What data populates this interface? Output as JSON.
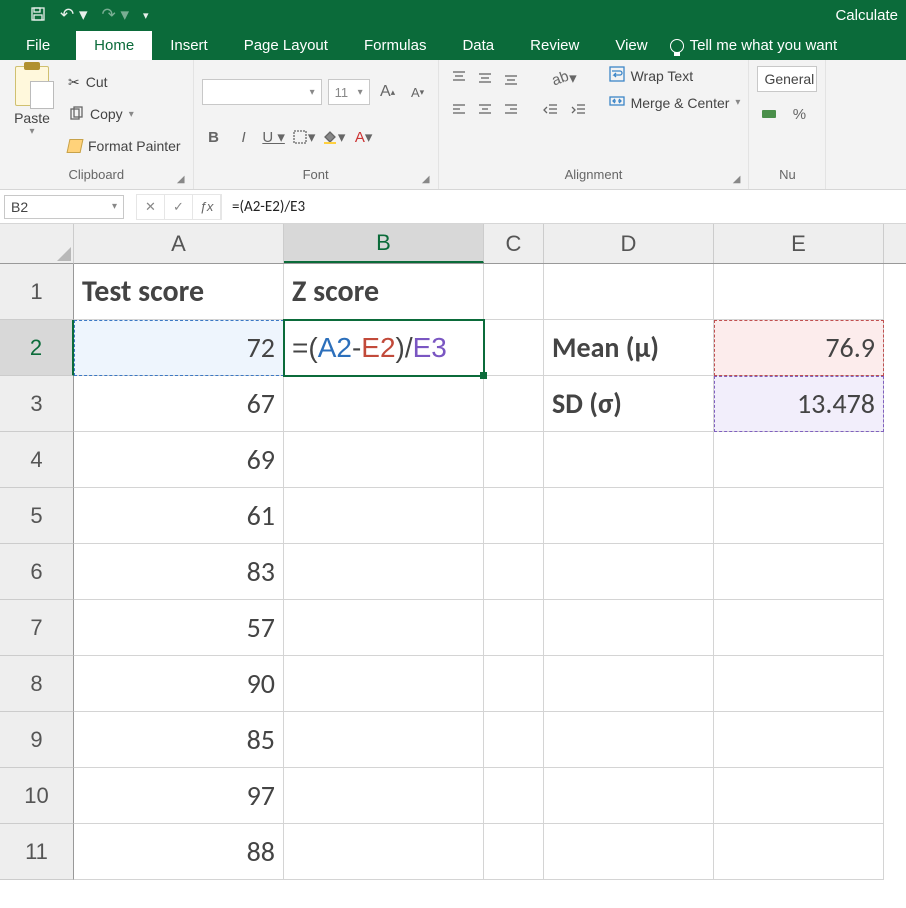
{
  "titlebar": {
    "status": "Calculate"
  },
  "tabs": {
    "items": [
      "File",
      "Home",
      "Insert",
      "Page Layout",
      "Formulas",
      "Data",
      "Review",
      "View"
    ],
    "active": "Home",
    "tell": "Tell me what you want"
  },
  "ribbon": {
    "clipboard": {
      "paste": "Paste",
      "cut": "Cut",
      "copy": "Copy",
      "formatpainter": "Format Painter",
      "label": "Clipboard"
    },
    "font": {
      "size": "11",
      "label": "Font"
    },
    "alignment": {
      "wrap": "Wrap Text",
      "merge": "Merge & Center",
      "label": "Alignment"
    },
    "number": {
      "format": "General",
      "label": "Nu"
    }
  },
  "fbar": {
    "name": "B2",
    "formula": "=(A2-E2)/E3"
  },
  "sheet": {
    "cols": [
      "A",
      "B",
      "C",
      "D",
      "E"
    ],
    "a1": "Test score",
    "b1": "Z score",
    "a": [
      "72",
      "67",
      "69",
      "61",
      "83",
      "57",
      "90",
      "85",
      "97",
      "88"
    ],
    "b2_formula": {
      "pre": "=(",
      "a": "A2",
      "mid1": "-",
      "e2": "E2",
      "mid2": ")/",
      "e3": "E3"
    },
    "d2": "Mean (μ)",
    "d3": "SD (σ)",
    "e2": "76.9",
    "e3": "13.478"
  }
}
